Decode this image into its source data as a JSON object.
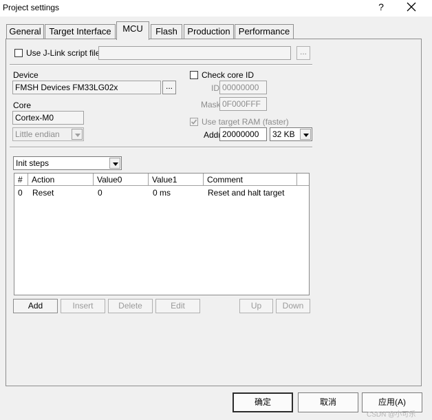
{
  "window": {
    "title": "Project settings",
    "help": "?"
  },
  "tabs": [
    {
      "label": "General"
    },
    {
      "label": "Target Interface"
    },
    {
      "label": "MCU"
    },
    {
      "label": "Flash"
    },
    {
      "label": "Production"
    },
    {
      "label": "Performance"
    }
  ],
  "jlink_script": {
    "label": "Use J-Link script file",
    "checked": false,
    "value": "",
    "browse": "..."
  },
  "device": {
    "label": "Device",
    "value": "FMSH Devices FM33LG02x",
    "browse": "..."
  },
  "core": {
    "label": "Core",
    "value": "Cortex-M0",
    "endian": "Little endian"
  },
  "core_id": {
    "label": "Check core ID",
    "checked": false,
    "id_label": "ID",
    "id_value": "00000000",
    "mask_label": "Mask",
    "mask_value": "0F000FFF"
  },
  "target_ram": {
    "label": "Use target RAM (faster)",
    "checked": true,
    "addr_label": "Addr",
    "addr_value": "20000000",
    "size": "32 KB"
  },
  "init_steps": {
    "selector": "Init steps",
    "columns": [
      "#",
      "Action",
      "Value0",
      "Value1",
      "Comment"
    ],
    "rows": [
      {
        "num": "0",
        "action": "Reset",
        "value0": "0",
        "value1": "0 ms",
        "comment": "Reset and halt target"
      }
    ]
  },
  "step_buttons": {
    "add": "Add",
    "insert": "Insert",
    "delete": "Delete",
    "edit": "Edit",
    "up": "Up",
    "down": "Down"
  },
  "dialog_buttons": {
    "ok": "确定",
    "cancel": "取消",
    "apply": "应用(A)"
  },
  "watermark": "CSDN @小可乐"
}
